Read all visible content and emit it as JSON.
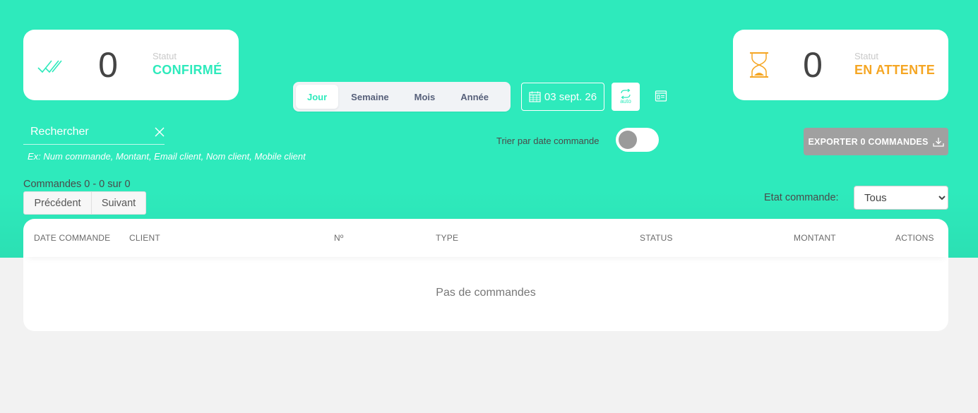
{
  "confirmed": {
    "count": "0",
    "label": "Statut",
    "status": "CONFIRMÉ",
    "icon": "double-check-icon",
    "color": "#2eeabc"
  },
  "pending": {
    "count": "0",
    "label": "Statut",
    "status": "EN ATTENTE",
    "icon": "hourglass-icon",
    "color": "#f5a623"
  },
  "period": {
    "options": [
      "Jour",
      "Semaine",
      "Mois",
      "Année"
    ],
    "selected": "Jour"
  },
  "date": {
    "value": "03 sept. 26",
    "icon": "calendar-icon"
  },
  "refresh": {
    "label": "auto",
    "icon": "refresh-icon"
  },
  "search": {
    "placeholder": "Rechercher",
    "hint": "Ex: Num commande, Montant, Email client, Nom client, Mobile client"
  },
  "sort": {
    "label": "Trier par date commande",
    "enabled": false
  },
  "export": {
    "label": "EXPORTER 0 COMMANDES",
    "icon": "download-icon"
  },
  "pagination": {
    "summary": "Commandes 0 - 0 sur 0",
    "prev_label": "Précédent",
    "next_label": "Suivant"
  },
  "filter": {
    "label": "Etat commande:",
    "selected": "Tous"
  },
  "table": {
    "columns": [
      "DATE COMMANDE",
      "CLIENT",
      "Nº",
      "TYPE",
      "STATUS",
      "MONTANT",
      "ACTIONS"
    ],
    "empty_message": "Pas de commandes"
  },
  "colors": {
    "brand": "#2eeabc",
    "pending": "#f5a623",
    "export_bg": "#a0a0a0",
    "page_bg": "#f2f2f2"
  }
}
